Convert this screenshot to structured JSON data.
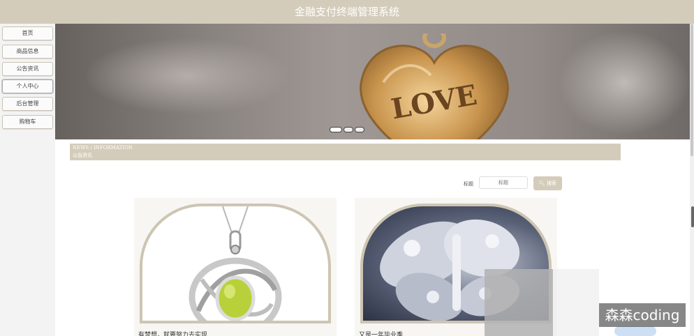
{
  "header": {
    "title": "金融支付终端管理系统"
  },
  "sidebar": {
    "items": [
      {
        "label": "首页"
      },
      {
        "label": "商品信息"
      },
      {
        "label": "公告资讯"
      },
      {
        "label": "个人中心"
      },
      {
        "label": "后台管理"
      },
      {
        "label": "购物车"
      }
    ]
  },
  "banner": {
    "image_text": "LOVE",
    "indicators": 3
  },
  "news": {
    "title_en": "NEWS / INFORMATION",
    "title_cn": "公告资讯"
  },
  "search": {
    "label": "标题",
    "placeholder": "标题",
    "button_label": "搜索"
  },
  "cards": [
    {
      "title": "有梦想，就要努力去实现"
    },
    {
      "title": "又是一年毕业季"
    }
  ],
  "watermark": {
    "text": "森森coding"
  },
  "colors": {
    "accent": "#d4ccbb",
    "header_text": "#ffffff"
  }
}
